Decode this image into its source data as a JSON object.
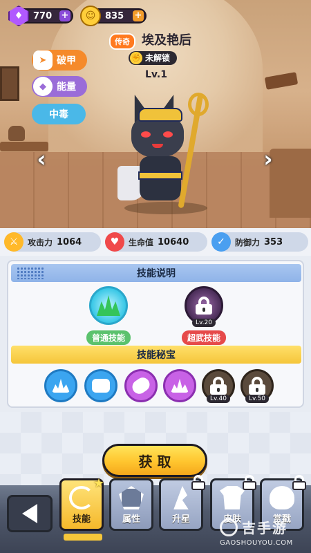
{
  "currency": {
    "gems": "770",
    "coins": "835",
    "gem_icon": "gem-icon",
    "coin_icon": "coin-icon",
    "plus": "+"
  },
  "hero": {
    "rarity": "传奇",
    "name": "埃及艳后",
    "lock_status": "未解锁",
    "level": "Lv.1"
  },
  "tags": {
    "armor_label": "破甲",
    "energy_label": "能量",
    "poison_label": "中毒"
  },
  "nav_arrows": {
    "left": "‹",
    "right": "›"
  },
  "stats": {
    "attack_label": "攻击力",
    "attack_value": "1064",
    "hp_label": "生命值",
    "hp_value": "10640",
    "defense_label": "防御力",
    "defense_value": "353"
  },
  "skills": {
    "section_title": "技能说明",
    "normal_label": "普通技能",
    "ultra_label": "超武技能",
    "ultra_lock_level": "Lv.20"
  },
  "treasures": {
    "section_title": "技能秘宝",
    "lock_levels": [
      "Lv.40",
      "Lv.50"
    ]
  },
  "actions": {
    "obtain_label": "获 取"
  },
  "tabs": {
    "skill": "技能",
    "attribute": "属性",
    "star_up": "升星",
    "skin": "皮肤",
    "favor": "赏戳"
  },
  "watermark": {
    "cn": "吉手游",
    "en": "GAOSHOUYOU.COM"
  },
  "colors": {
    "accent_yellow": "#f5c63a",
    "skill_blue": "#3ba5f0",
    "skill_purple": "#c862e6",
    "hp_red": "#f0494a"
  }
}
